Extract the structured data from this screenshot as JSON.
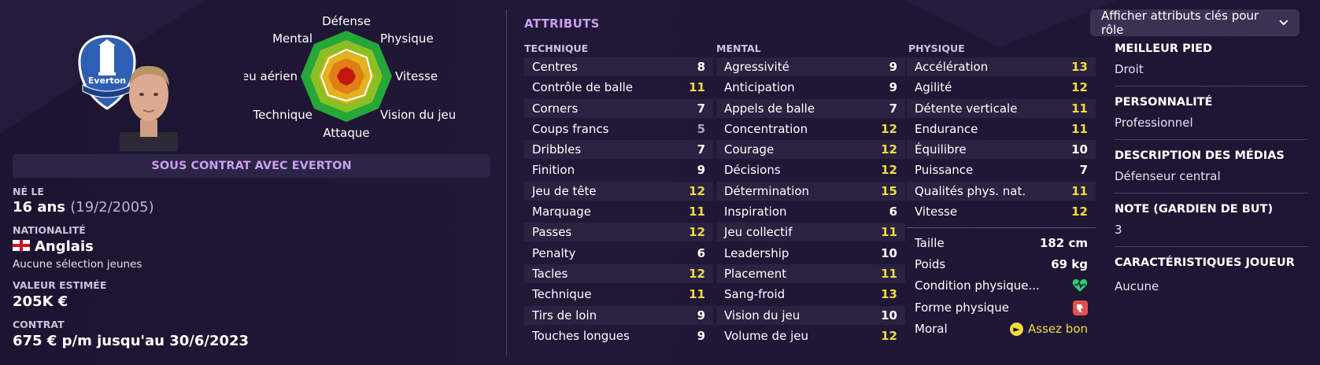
{
  "profile": {
    "contract_banner": "SOUS CONTRAT AVEC EVERTON",
    "crest_text": "Everton",
    "born_label": "NÉ LE",
    "age": "16 ans",
    "birthdate": "(19/2/2005)",
    "nationality_label": "NATIONALITÉ",
    "nationality": "Anglais",
    "caps": "Aucune sélection jeunes",
    "value_label": "VALEUR ESTIMÉE",
    "value": "205K €",
    "contract_label": "CONTRAT",
    "contract": "675 € p/m jusqu'au 30/6/2023"
  },
  "radar": {
    "labels": [
      "Défense",
      "Physique",
      "Vitesse",
      "Vision du jeu",
      "Attaque",
      "Technique",
      "Jeu aérien",
      "Mental"
    ]
  },
  "attributes": {
    "title": "ATTRIBUTS",
    "technique_header": "TECHNIQUE",
    "mental_header": "MENTAL",
    "physique_header": "PHYSIQUE",
    "technique": [
      {
        "name": "Centres",
        "value": "8",
        "color": "#ffffff"
      },
      {
        "name": "Contrôle de balle",
        "value": "11",
        "color": "#f2dc3c"
      },
      {
        "name": "Corners",
        "value": "7",
        "color": "#ffffff"
      },
      {
        "name": "Coups francs",
        "value": "5",
        "color": "#a9a3b8"
      },
      {
        "name": "Dribbles",
        "value": "7",
        "color": "#ffffff"
      },
      {
        "name": "Finition",
        "value": "9",
        "color": "#ffffff"
      },
      {
        "name": "Jeu de tête",
        "value": "12",
        "color": "#f2dc3c"
      },
      {
        "name": "Marquage",
        "value": "11",
        "color": "#f2dc3c"
      },
      {
        "name": "Passes",
        "value": "12",
        "color": "#f2dc3c"
      },
      {
        "name": "Penalty",
        "value": "6",
        "color": "#ffffff"
      },
      {
        "name": "Tacles",
        "value": "12",
        "color": "#f2dc3c"
      },
      {
        "name": "Technique",
        "value": "11",
        "color": "#f2dc3c"
      },
      {
        "name": "Tirs de loin",
        "value": "9",
        "color": "#ffffff"
      },
      {
        "name": "Touches longues",
        "value": "9",
        "color": "#ffffff"
      }
    ],
    "mental": [
      {
        "name": "Agressivité",
        "value": "9",
        "color": "#ffffff"
      },
      {
        "name": "Anticipation",
        "value": "9",
        "color": "#ffffff"
      },
      {
        "name": "Appels de balle",
        "value": "7",
        "color": "#ffffff"
      },
      {
        "name": "Concentration",
        "value": "12",
        "color": "#f2dc3c"
      },
      {
        "name": "Courage",
        "value": "12",
        "color": "#f2dc3c"
      },
      {
        "name": "Décisions",
        "value": "12",
        "color": "#f2dc3c"
      },
      {
        "name": "Détermination",
        "value": "15",
        "color": "#f2dc3c"
      },
      {
        "name": "Inspiration",
        "value": "6",
        "color": "#ffffff"
      },
      {
        "name": "Jeu collectif",
        "value": "11",
        "color": "#f2dc3c"
      },
      {
        "name": "Leadership",
        "value": "10",
        "color": "#ffffff"
      },
      {
        "name": "Placement",
        "value": "11",
        "color": "#f2dc3c"
      },
      {
        "name": "Sang-froid",
        "value": "13",
        "color": "#f2dc3c"
      },
      {
        "name": "Vision du jeu",
        "value": "10",
        "color": "#ffffff"
      },
      {
        "name": "Volume de jeu",
        "value": "12",
        "color": "#f2dc3c"
      }
    ],
    "physique": [
      {
        "name": "Accélération",
        "value": "13",
        "color": "#f2dc3c"
      },
      {
        "name": "Agilité",
        "value": "12",
        "color": "#f2dc3c"
      },
      {
        "name": "Détente verticale",
        "value": "11",
        "color": "#f2dc3c"
      },
      {
        "name": "Endurance",
        "value": "11",
        "color": "#f2dc3c"
      },
      {
        "name": "Équilibre",
        "value": "10",
        "color": "#ffffff"
      },
      {
        "name": "Puissance",
        "value": "7",
        "color": "#ffffff"
      },
      {
        "name": "Qualités phys. nat.",
        "value": "11",
        "color": "#f2dc3c"
      },
      {
        "name": "Vitesse",
        "value": "12",
        "color": "#f2dc3c"
      }
    ],
    "height_label": "Taille",
    "height": "182 cm",
    "weight_label": "Poids",
    "weight": "69 kg",
    "condition_label": "Condition physique...",
    "condition_icon": "heart-icon",
    "form_label": "Forme physique",
    "form_icon": "thumbs-down-icon",
    "morale_label": "Moral",
    "morale": "Assez bon",
    "morale_icon": "arrow-right-icon"
  },
  "sidebar": {
    "dropdown": "Afficher attributs clés pour rôle",
    "best_foot_label": "MEILLEUR PIED",
    "best_foot": "Droit",
    "personality_label": "PERSONNALITÉ",
    "personality": "Professionnel",
    "media_label": "DESCRIPTION DES MÉDIAS",
    "media": "Défenseur central",
    "gk_label": "NOTE (GARDIEN DE BUT)",
    "gk": "3",
    "traits_label": "CARACTÉRISTIQUES JOUEUR",
    "traits": "Aucune"
  },
  "colors": {
    "accent": "#c99ef0",
    "highlight": "#f2dc3c",
    "background": "#1c1430",
    "row_alt": "#2a2240"
  }
}
